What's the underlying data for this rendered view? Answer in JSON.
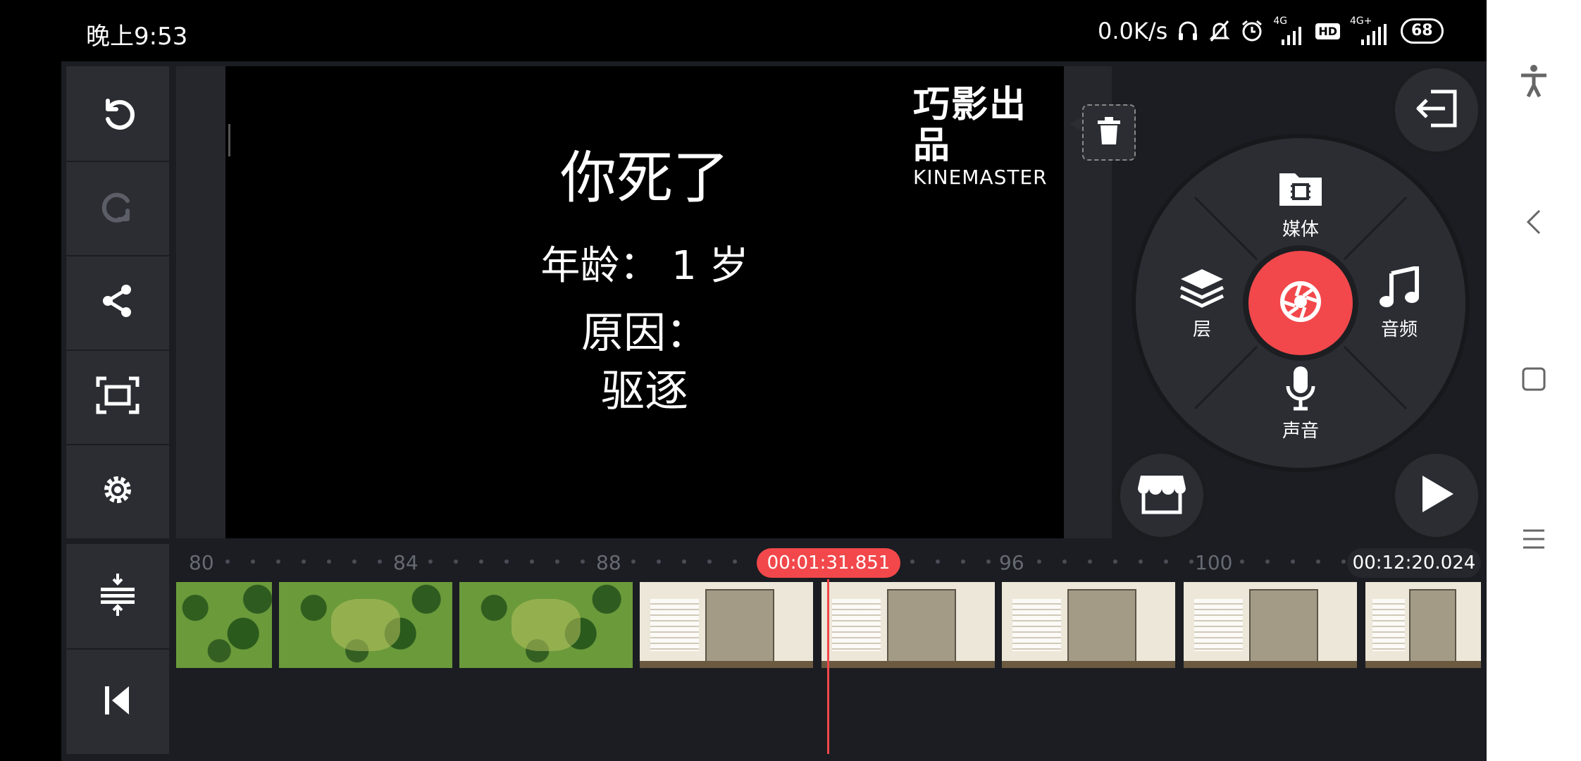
{
  "status_bar": {
    "time": "晚上9:53",
    "network_speed": "0.0K/s",
    "signal1_label": "4G",
    "hd_label": "HD",
    "signal2_label": "4G+",
    "battery": "68"
  },
  "preview": {
    "title": "你死了",
    "age_line": "年龄： 1 岁",
    "reason_label": "原因：",
    "reason_value": "驱逐",
    "logo_top": "巧影出品",
    "logo_bottom": "KINEMASTER"
  },
  "wheel": {
    "media_label": "媒体",
    "layer_label": "层",
    "audio_label": "音频",
    "voice_label": "声音"
  },
  "timeline": {
    "ticks": [
      "80",
      "84",
      "88",
      "96",
      "100"
    ],
    "current_time": "00:01:31.851",
    "total_time": "00:12:20.024"
  },
  "colors": {
    "accent": "#f2484b",
    "panel": "#2b2d33",
    "background": "#1b1d22"
  },
  "icons": {
    "left_toolbar": [
      "undo-icon",
      "redo-icon",
      "share-icon",
      "fullscreen-icon",
      "settings-icon"
    ],
    "left_bottom": [
      "expand-timeline-icon",
      "skip-to-start-icon"
    ],
    "right": [
      "exit-icon",
      "trash-icon",
      "record-icon",
      "store-icon",
      "play-icon"
    ],
    "navbar": [
      "accessibility-icon",
      "back-icon",
      "home-icon",
      "menu-icon"
    ]
  }
}
